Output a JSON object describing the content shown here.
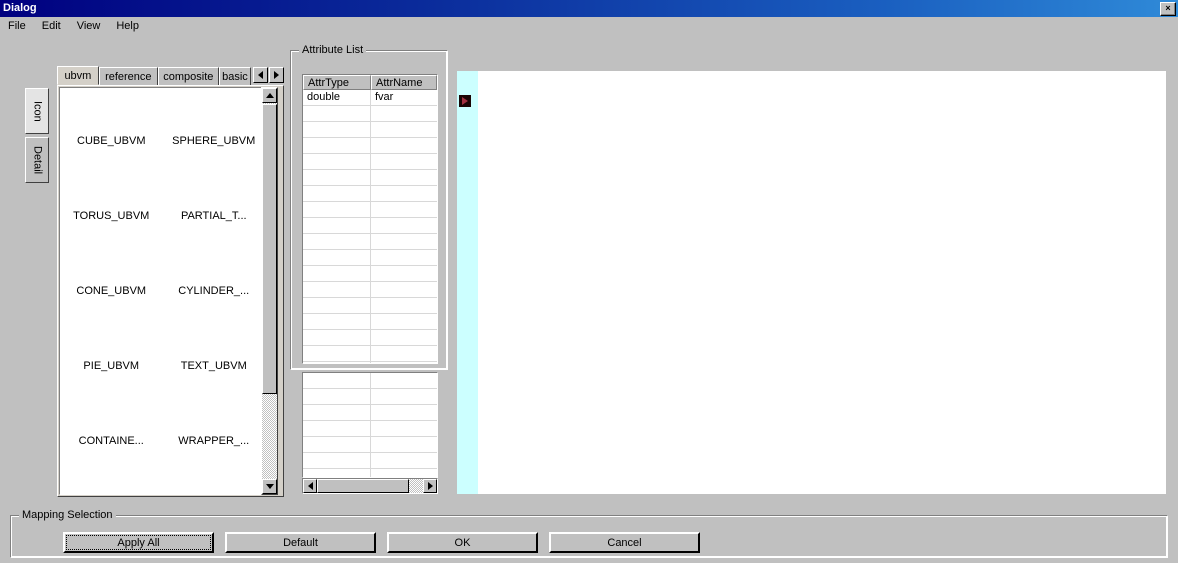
{
  "window": {
    "title": "Dialog",
    "close_label": "×",
    "titlebar_color_left": "#000080",
    "titlebar_color_right": "#2f8ad8"
  },
  "menubar": {
    "items": [
      {
        "label": "File"
      },
      {
        "label": "Edit"
      },
      {
        "label": "View"
      },
      {
        "label": "Help"
      }
    ]
  },
  "view_tabs": {
    "items": [
      {
        "label": "Icon",
        "selected": true
      },
      {
        "label": "Detail",
        "selected": false
      }
    ]
  },
  "library_tabs": {
    "items": [
      {
        "label": "ubvm",
        "selected": true
      },
      {
        "label": "reference",
        "selected": false
      },
      {
        "label": "composite",
        "selected": false
      },
      {
        "label": "basic",
        "selected": false
      }
    ],
    "scroll_prev": "◄",
    "scroll_next": "►"
  },
  "icon_list": {
    "rows": [
      {
        "left": "CUBE_UBVM",
        "right": "SPHERE_UBVM"
      },
      {
        "left": "TORUS_UBVM",
        "right": "PARTIAL_T..."
      },
      {
        "left": "CONE_UBVM",
        "right": "CYLINDER_..."
      },
      {
        "left": "PIE_UBVM",
        "right": "TEXT_UBVM"
      },
      {
        "left": "CONTAINE...",
        "right": "WRAPPER_..."
      }
    ]
  },
  "attribute_list": {
    "group_label": "Attribute List",
    "columns": [
      "AttrType",
      "AttrName"
    ],
    "rows": [
      {
        "AttrType": "double",
        "AttrName": "fvar"
      }
    ],
    "empty_row_count": 17,
    "secondary_empty_row_count": 7
  },
  "canvas": {
    "strip_color": "#ccffff",
    "background_color": "#ffffff",
    "icon_name": "play-marker-icon"
  },
  "mapping_selection": {
    "group_label": "Mapping Selection",
    "buttons": [
      {
        "label": "Apply All",
        "focused": true
      },
      {
        "label": "Default",
        "focused": false
      },
      {
        "label": "OK",
        "focused": false
      },
      {
        "label": "Cancel",
        "focused": false
      }
    ]
  }
}
